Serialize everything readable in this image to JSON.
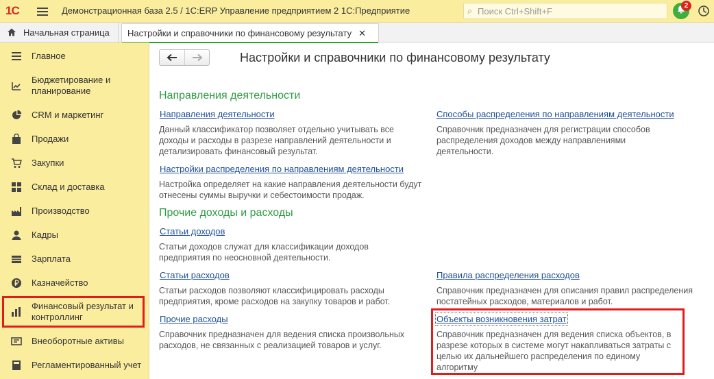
{
  "header": {
    "logo": "1С",
    "title": "Демонстрационная база 2.5 / 1С:ERP Управление предприятием 2 1С:Предприятие",
    "search_placeholder": "Поиск Ctrl+Shift+F",
    "notifications_count": "2"
  },
  "tabs": {
    "home_label": "Начальная страница",
    "active_label": "Настройки и справочники по финансовому результату"
  },
  "sidebar": {
    "items": [
      {
        "label": "Главное",
        "icon": "menu-icon"
      },
      {
        "label": "Бюджетирование и планирование",
        "icon": "budget-icon"
      },
      {
        "label": "CRM и маркетинг",
        "icon": "pie-chart-icon"
      },
      {
        "label": "Продажи",
        "icon": "shopping-bag-icon"
      },
      {
        "label": "Закупки",
        "icon": "cart-icon"
      },
      {
        "label": "Склад и доставка",
        "icon": "warehouse-icon"
      },
      {
        "label": "Производство",
        "icon": "factory-icon"
      },
      {
        "label": "Кадры",
        "icon": "person-icon"
      },
      {
        "label": "Зарплата",
        "icon": "payroll-icon"
      },
      {
        "label": "Казначейство",
        "icon": "ruble-icon"
      },
      {
        "label": "Финансовый результат и контроллинг",
        "icon": "bar-chart-icon"
      },
      {
        "label": "Внеоборотные активы",
        "icon": "assets-icon"
      },
      {
        "label": "Регламентированный учет",
        "icon": "accounting-icon"
      }
    ]
  },
  "main": {
    "title": "Настройки и справочники по финансовому результату",
    "sections": [
      {
        "title": "Направления деятельности"
      },
      {
        "title": "Прочие доходы и расходы"
      }
    ],
    "entries": [
      {
        "link": "Направления деятельности",
        "desc": "Данный классификатор позволяет отдельно учитывать все доходы и расходы в разрезе направлений деятельности и детализировать финансовый результат."
      },
      {
        "link": "Способы распределения по направлениям деятельности",
        "desc": "Справочник предназначен для регистрации способов распределения доходов между направлениями деятельности."
      },
      {
        "link": "Настройки распределения по направлениям деятельности",
        "desc": "Настройка определяет на какие направления деятельности будут отнесены суммы выручки и себестоимости продаж."
      },
      {
        "link": "Статьи доходов",
        "desc": "Статьи доходов служат для классификации доходов предприятия по неосновной деятельности."
      },
      {
        "link": "Статьи расходов",
        "desc": "Статьи расходов позволяют классифицировать расходы предприятия, кроме расходов на закупку товаров и работ."
      },
      {
        "link": "Правила распределения расходов",
        "desc": "Справочник предназначен для описания правил распределения постатейных расходов, материалов и работ."
      },
      {
        "link": "Прочие расходы",
        "desc": "Справочник предназначен для ведения списка произвольных расходов, не связанных с реализацией товаров и услуг."
      },
      {
        "link": "Объекты возникновения затрат",
        "desc": "Справочник предназначен для ведения списка объектов, в разрезе которых в системе могут накапливаться затраты с целью их дальнейшего распределения по единому алгоритму"
      }
    ]
  },
  "colors": {
    "panel": "#fbed9e",
    "accent_green": "#2e9b45",
    "link_blue": "#1e4e98",
    "highlight_red": "#e41b1b"
  }
}
